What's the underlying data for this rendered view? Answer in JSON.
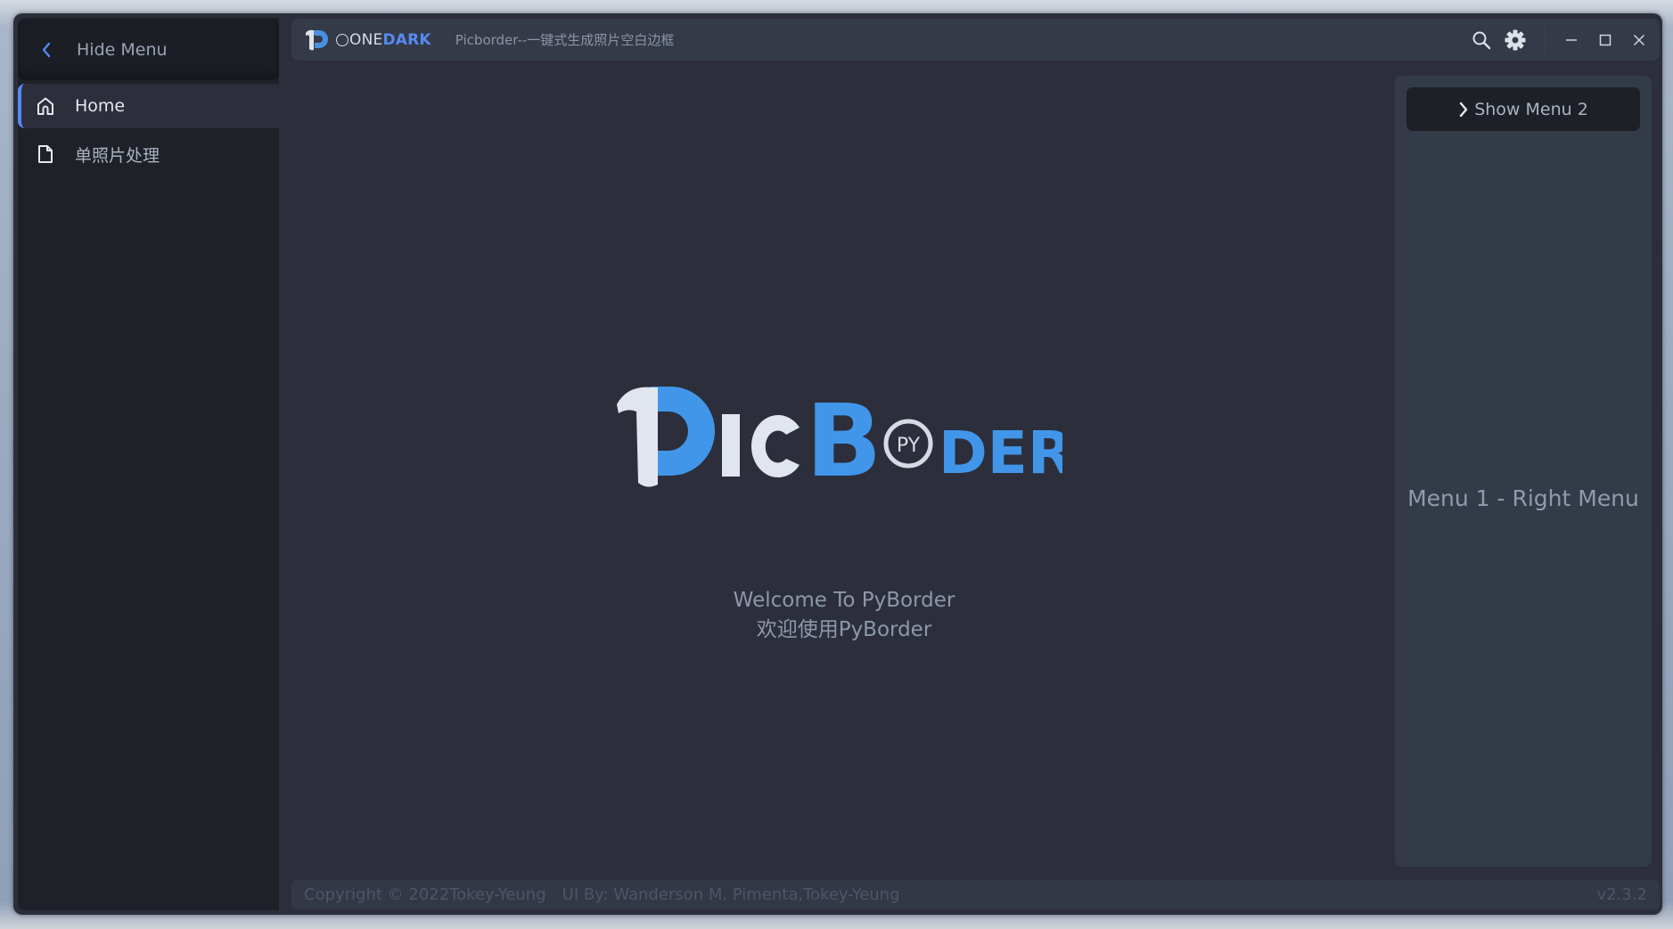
{
  "window": {
    "colors": {
      "accent": "#568af2",
      "background": "#2c2f3b",
      "sidebar": "#1e2127",
      "panel": "#343b48"
    }
  },
  "left_menu": {
    "toggle": {
      "label": "Hide Menu",
      "icon": "chevron-left-icon"
    },
    "items": [
      {
        "label": "Home",
        "icon": "home-icon",
        "active": true
      },
      {
        "label": "单照片处理",
        "icon": "file-icon",
        "active": false
      }
    ]
  },
  "title_bar": {
    "brand_one": "ONE",
    "brand_dark": "DARK",
    "title": "Picborder--一键式生成照片空白边框",
    "icons": [
      "search-icon",
      "settings-gear-icon"
    ],
    "window_controls": [
      "minimize-icon",
      "maximize-icon",
      "close-icon"
    ]
  },
  "main": {
    "logo": {
      "part1": "P",
      "part2": "IC",
      "part3": "B",
      "badge": "PY",
      "part4": "DER"
    },
    "welcome_en": "Welcome To PyBorder",
    "welcome_cn": "欢迎使用PyBorder"
  },
  "right_menu": {
    "button_label": "Show Menu 2",
    "text": "Menu 1 - Right Menu"
  },
  "footer": {
    "copyright": "Copyright © 2022Tokey-Yeung",
    "ui_by": "UI By: Wanderson M. Pimenta,Tokey-Yeung",
    "version": "v2.3.2"
  }
}
